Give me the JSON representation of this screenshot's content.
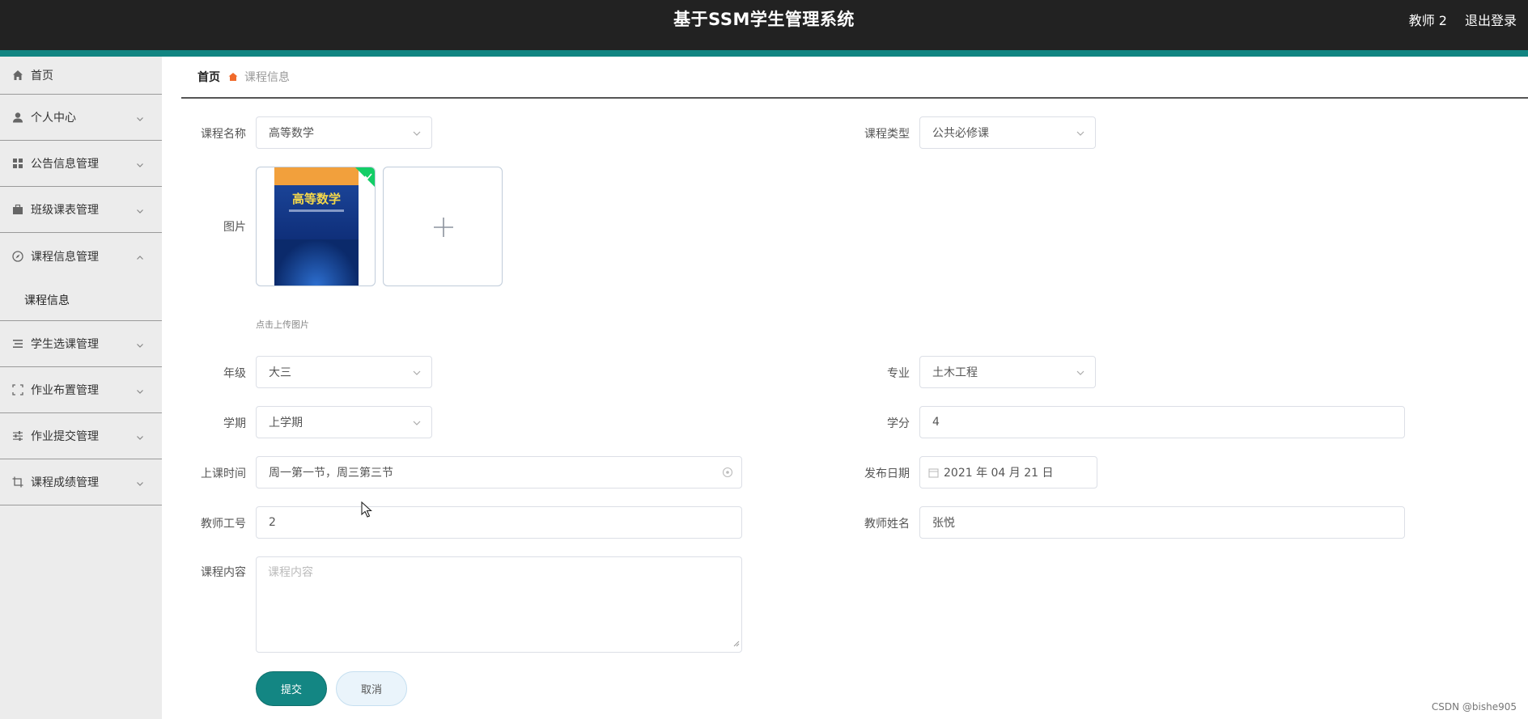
{
  "header": {
    "title": "基于SSM学生管理系统",
    "user": "教师 2",
    "logout": "退出登录"
  },
  "sidebar": {
    "items": [
      {
        "label": "首页",
        "icon": "home-icon"
      },
      {
        "label": "个人中心",
        "icon": "user-icon"
      },
      {
        "label": "公告信息管理",
        "icon": "grid-icon"
      },
      {
        "label": "班级课表管理",
        "icon": "briefcase-icon"
      },
      {
        "label": "课程信息管理",
        "icon": "compass-icon",
        "expanded": true
      },
      {
        "label": "学生选课管理",
        "icon": "list-icon"
      },
      {
        "label": "作业布置管理",
        "icon": "fullscreen-icon"
      },
      {
        "label": "作业提交管理",
        "icon": "sliders-icon"
      },
      {
        "label": "课程成绩管理",
        "icon": "crop-icon"
      }
    ],
    "sub_item": "课程信息"
  },
  "breadcrumb": {
    "home": "首页",
    "current": "课程信息"
  },
  "form": {
    "course_name": {
      "label": "课程名称",
      "value": "高等数学"
    },
    "course_type": {
      "label": "课程类型",
      "value": "公共必修课"
    },
    "image": {
      "label": "图片",
      "hint": "点击上传图片",
      "book_title": "高等数学"
    },
    "grade": {
      "label": "年级",
      "value": "大三"
    },
    "major": {
      "label": "专业",
      "value": "土木工程"
    },
    "semester": {
      "label": "学期",
      "value": "上学期"
    },
    "credit": {
      "label": "学分",
      "value": "4"
    },
    "class_time": {
      "label": "上课时间",
      "value": "周一第一节，周三第三节"
    },
    "publish_date": {
      "label": "发布日期",
      "value": "2021 年 04 月 21 日"
    },
    "teacher_id": {
      "label": "教师工号",
      "value": "2"
    },
    "teacher_name": {
      "label": "教师姓名",
      "value": "张悦"
    },
    "content": {
      "label": "课程内容",
      "placeholder": "课程内容"
    }
  },
  "buttons": {
    "submit": "提交",
    "cancel": "取消"
  },
  "watermark": "CSDN @bishe905",
  "colors": {
    "header_bg": "#222222",
    "accent": "#138683",
    "sidebar_bg": "#ececec"
  }
}
